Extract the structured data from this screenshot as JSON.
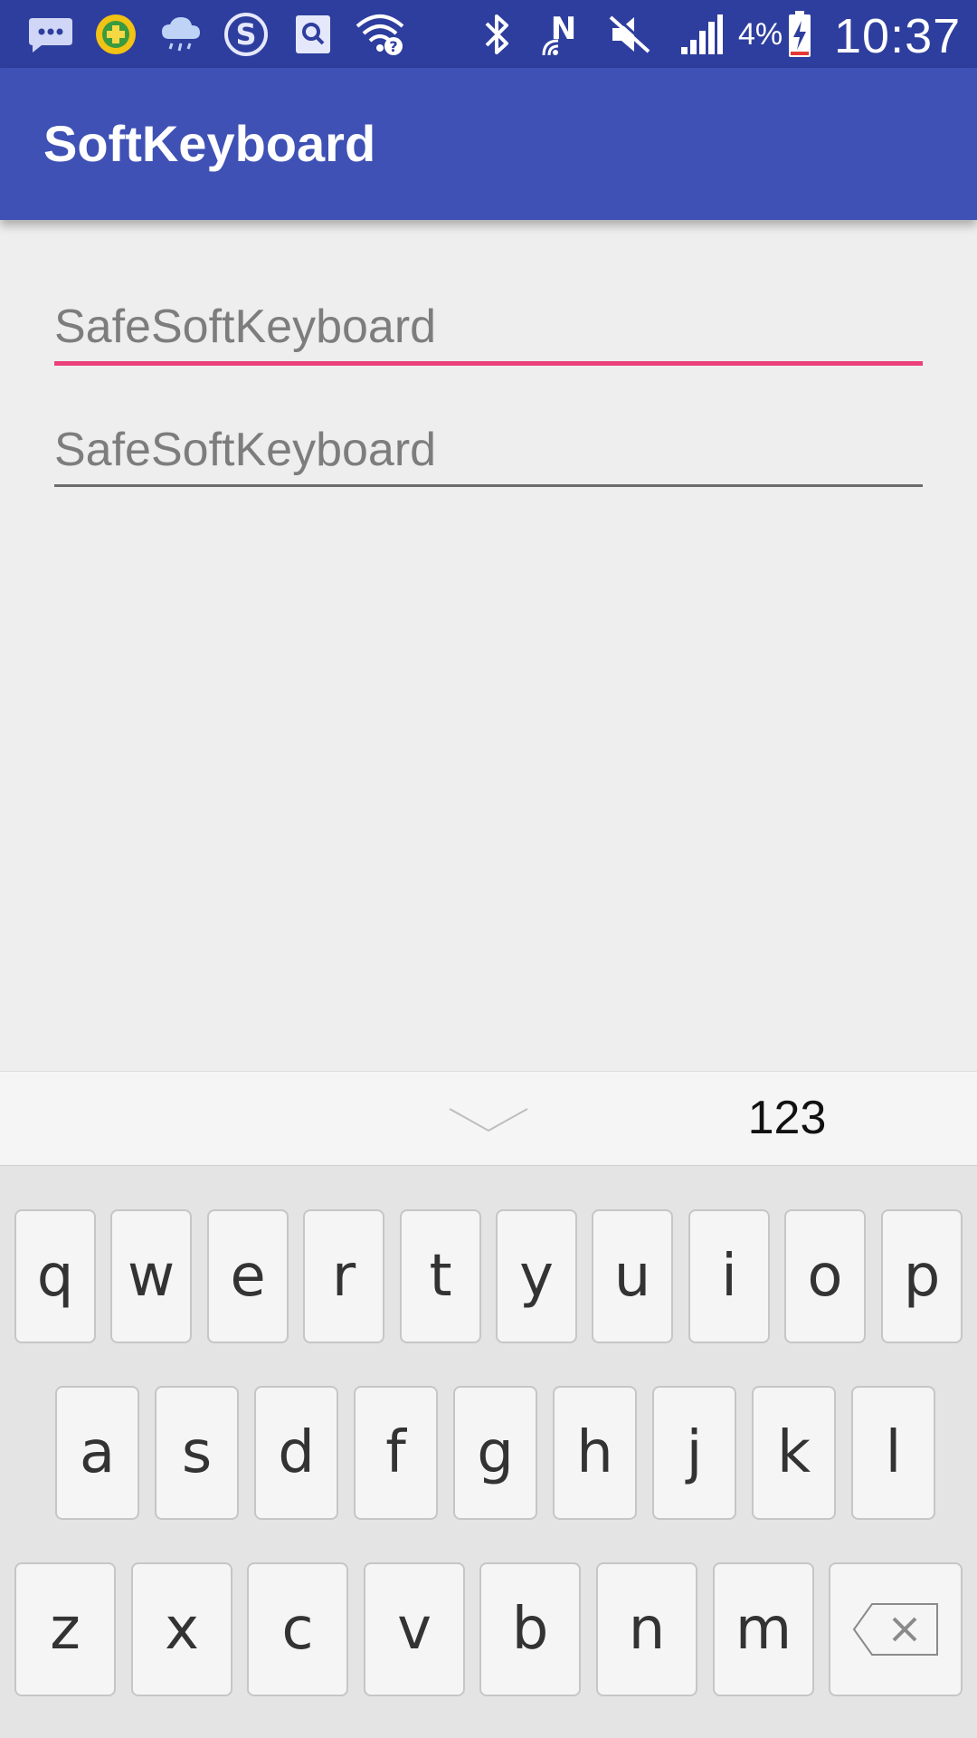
{
  "status_bar": {
    "battery_percent": "4%",
    "time": "10:37",
    "icons": [
      "message-icon",
      "security-app-icon",
      "weather-cloud-icon",
      "sogou-s-icon",
      "search-app-icon",
      "wifi-question-icon",
      "bluetooth-icon",
      "nfc-icon",
      "mute-icon",
      "signal-icon",
      "battery-charging-icon"
    ],
    "colors": {
      "background": "#2e3e9e"
    }
  },
  "app_bar": {
    "title": "SoftKeyboard",
    "color": "#3f51b5"
  },
  "fields": [
    {
      "placeholder": "SafeSoftKeyboard",
      "value": "",
      "focused": true,
      "accent": "#ec407a"
    },
    {
      "placeholder": "SafeSoftKeyboard",
      "value": "",
      "focused": false
    }
  ],
  "keyboard": {
    "toolbar": {
      "collapse_icon": "chevron-down-icon",
      "mode_label": "123"
    },
    "rows": [
      [
        "q",
        "w",
        "e",
        "r",
        "t",
        "y",
        "u",
        "i",
        "o",
        "p"
      ],
      [
        "a",
        "s",
        "d",
        "f",
        "g",
        "h",
        "j",
        "k",
        "l"
      ],
      [
        "z",
        "x",
        "c",
        "v",
        "b",
        "n",
        "m"
      ]
    ],
    "backspace_icon": "backspace-icon"
  }
}
